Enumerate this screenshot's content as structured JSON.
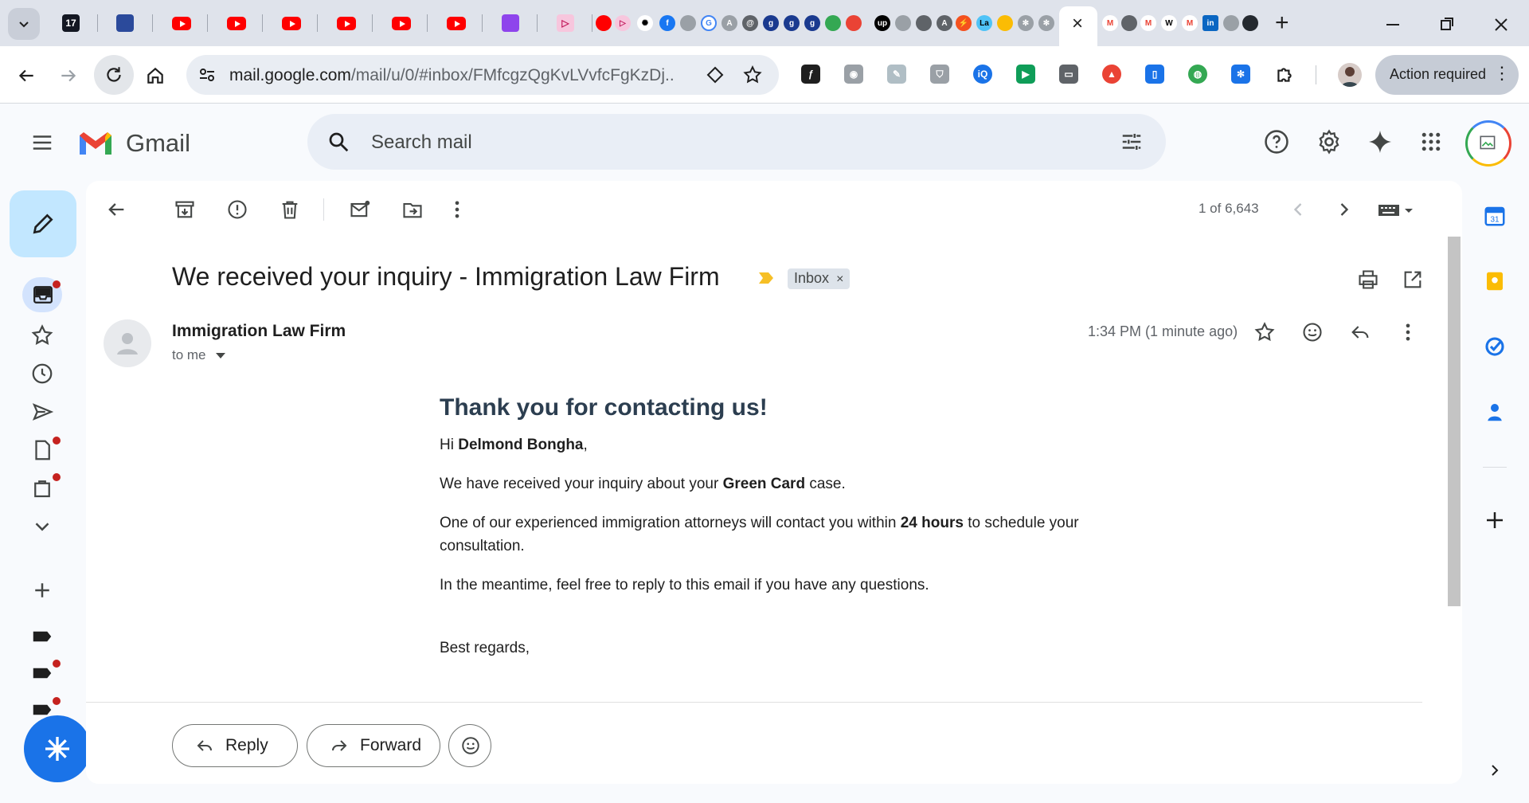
{
  "browser": {
    "url_host": "mail.google.com",
    "url_path": "/mail/u/0/#inbox/FMfcgzQgKvLVvfcFgKzDj...",
    "action_required_label": "Action required",
    "tab_close": "×",
    "new_tab": "+",
    "ext_la": "La",
    "ext_in": "in",
    "ext_f": "f",
    "ext_g1": "g",
    "ext_g2": "g",
    "ext_g3": "g",
    "ext_up": "up",
    "ext_iq": "iQ",
    "ext_17": "17"
  },
  "gmail": {
    "brand": "Gmail",
    "search_placeholder": "Search mail"
  },
  "toolbar": {
    "counter": "1 of 6,643"
  },
  "email": {
    "subject": "We received your inquiry - Immigration Law Firm",
    "label_chip": "Inbox",
    "label_chip_close": "×",
    "sender": "Immigration Law Firm",
    "recipient": "to me",
    "time": "1:34 PM (1 minute ago)",
    "body": {
      "heading": "Thank you for contacting us!",
      "greeting_prefix": "Hi ",
      "greeting_name": "Delmond Bongha",
      "greeting_suffix": ",",
      "p1_prefix": "We have received your inquiry about your ",
      "p1_bold": "Green Card",
      "p1_suffix": " case.",
      "p2_prefix": "One of our experienced immigration attorneys will contact you within ",
      "p2_bold": "24 hours",
      "p2_suffix": " to schedule your consultation.",
      "p3": "In the meantime, feel free to reply to this email if you have any questions.",
      "signoff": "Best regards,"
    }
  },
  "actions": {
    "reply_label": "Reply",
    "forward_label": "Forward"
  }
}
